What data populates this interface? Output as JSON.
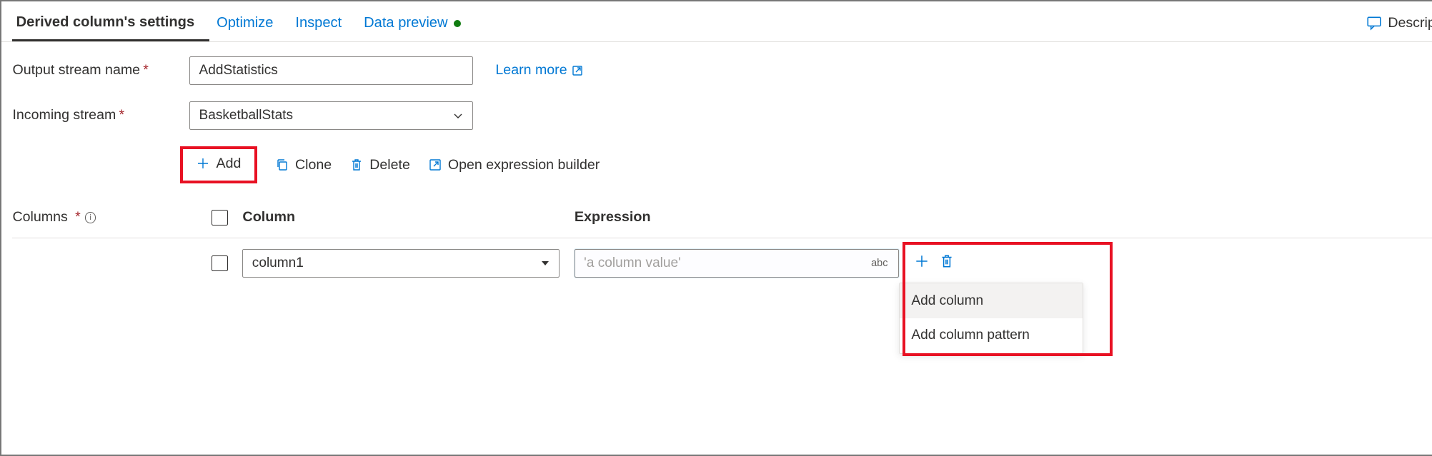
{
  "tabs": {
    "settings": "Derived column's settings",
    "optimize": "Optimize",
    "inspect": "Inspect",
    "preview": "Data preview"
  },
  "description_label": "Description",
  "form": {
    "output_label": "Output stream name",
    "output_value": "AddStatistics",
    "learn_more": "Learn more",
    "incoming_label": "Incoming stream",
    "incoming_value": "BasketballStats",
    "columns_label": "Columns"
  },
  "toolbar": {
    "add": "Add",
    "clone": "Clone",
    "delete": "Delete",
    "open_expr": "Open expression builder"
  },
  "grid": {
    "header_column": "Column",
    "header_expression": "Expression",
    "row": {
      "column_value": "column1",
      "expression_placeholder": "'a column value'",
      "type_chip": "abc"
    }
  },
  "menu": {
    "add_column": "Add column",
    "add_pattern": "Add column pattern"
  }
}
